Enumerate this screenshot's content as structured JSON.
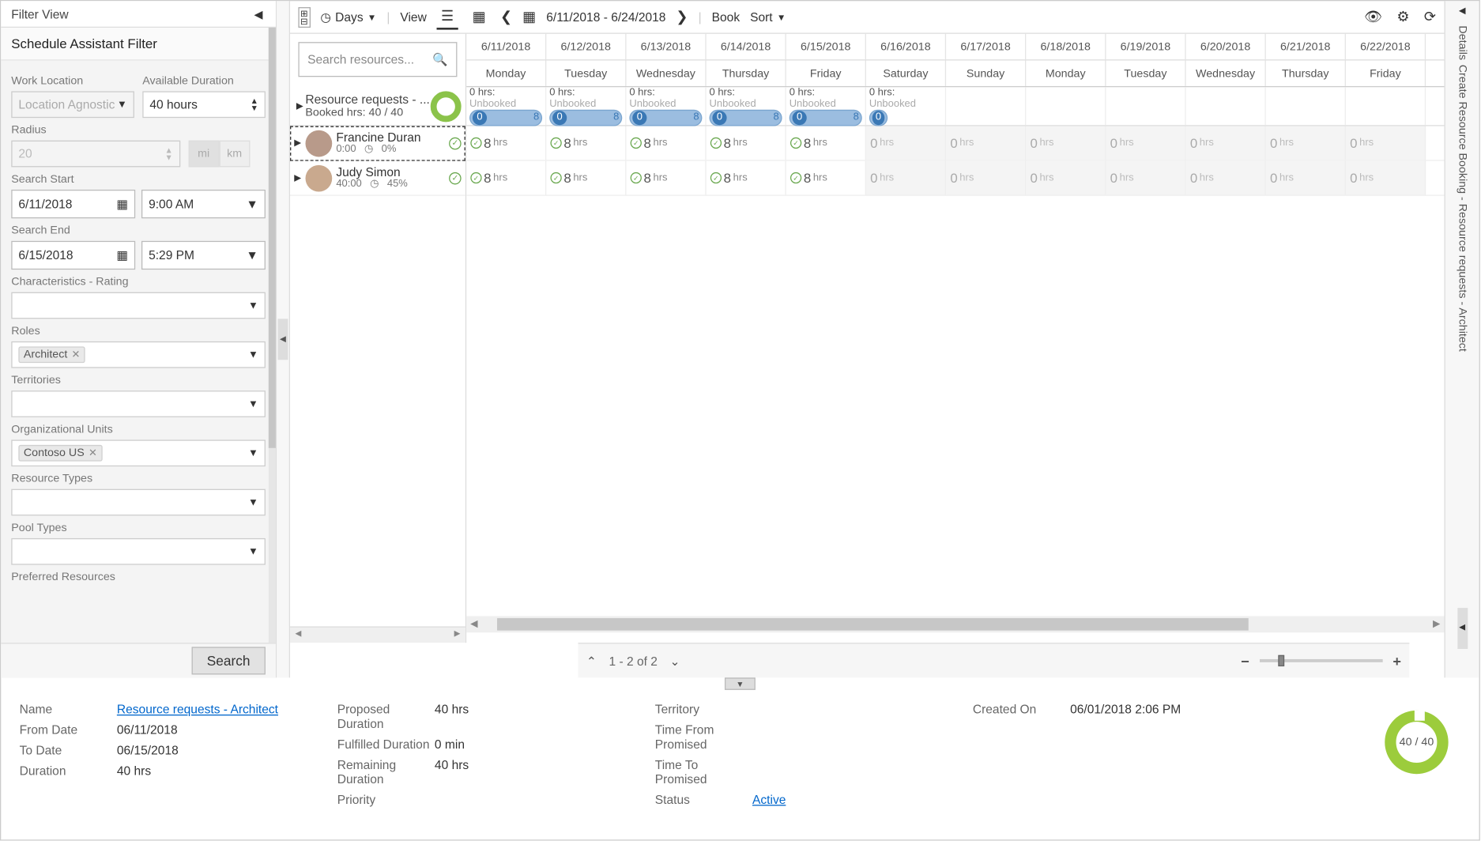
{
  "filterView": {
    "title": "Filter View",
    "subtitle": "Schedule Assistant Filter"
  },
  "filters": {
    "workLocation": {
      "label": "Work Location",
      "value": "Location Agnostic"
    },
    "availDuration": {
      "label": "Available Duration",
      "value": "40 hours"
    },
    "radius": {
      "label": "Radius",
      "value": "20",
      "units": [
        "mi",
        "km"
      ]
    },
    "searchStart": {
      "label": "Search Start",
      "date": "6/11/2018",
      "time": "9:00 AM"
    },
    "searchEnd": {
      "label": "Search End",
      "date": "6/15/2018",
      "time": "5:29 PM"
    },
    "characteristics": {
      "label": "Characteristics - Rating"
    },
    "roles": {
      "label": "Roles",
      "tags": [
        "Architect"
      ]
    },
    "territories": {
      "label": "Territories"
    },
    "orgUnits": {
      "label": "Organizational Units",
      "tags": [
        "Contoso US"
      ]
    },
    "resourceTypes": {
      "label": "Resource Types"
    },
    "poolTypes": {
      "label": "Pool Types"
    },
    "preferred": {
      "label": "Preferred Resources"
    },
    "searchBtn": "Search"
  },
  "toolbar": {
    "days": "Days",
    "view": "View",
    "dateRange": "6/11/2018 - 6/24/2018",
    "book": "Book",
    "sort": "Sort"
  },
  "columns": [
    {
      "date": "6/11/2018",
      "day": "Monday"
    },
    {
      "date": "6/12/2018",
      "day": "Tuesday"
    },
    {
      "date": "6/13/2018",
      "day": "Wednesday"
    },
    {
      "date": "6/14/2018",
      "day": "Thursday"
    },
    {
      "date": "6/15/2018",
      "day": "Friday"
    },
    {
      "date": "6/16/2018",
      "day": "Saturday"
    },
    {
      "date": "6/17/2018",
      "day": "Sunday"
    },
    {
      "date": "6/18/2018",
      "day": "Monday"
    },
    {
      "date": "6/19/2018",
      "day": "Tuesday"
    },
    {
      "date": "6/20/2018",
      "day": "Wednesday"
    },
    {
      "date": "6/21/2018",
      "day": "Thursday"
    },
    {
      "date": "6/22/2018",
      "day": "Friday"
    }
  ],
  "searchRes": {
    "placeholder": "Search resources..."
  },
  "request": {
    "title": "Resource requests - ...",
    "sub": "Booked hrs: 40 / 40",
    "unbooked": "0 hrs:",
    "unbookedLbl": "Unbooked",
    "pillA": "0",
    "pillB": "8"
  },
  "resources": [
    {
      "name": "Francine Duran",
      "h": "0:00",
      "pct": "0%",
      "sel": true
    },
    {
      "name": "Judy Simon",
      "h": "40:00",
      "pct": "45%",
      "sel": false
    }
  ],
  "cells": {
    "avail8": "8",
    "availT": "hrs",
    "zero": "0"
  },
  "pager": {
    "text": "1 - 2 of 2"
  },
  "rightRail": {
    "t1": "Details",
    "t2": "Create Resource Booking - Resource requests - Architect"
  },
  "details": {
    "name": {
      "l": "Name",
      "v": "Resource requests - Architect"
    },
    "from": {
      "l": "From Date",
      "v": "06/11/2018"
    },
    "to": {
      "l": "To Date",
      "v": "06/15/2018"
    },
    "dur": {
      "l": "Duration",
      "v": "40 hrs"
    },
    "prop": {
      "l": "Proposed Duration",
      "v": "40 hrs"
    },
    "ful": {
      "l": "Fulfilled Duration",
      "v": "0 min"
    },
    "rem": {
      "l": "Remaining Duration",
      "v": "40 hrs"
    },
    "pri": {
      "l": "Priority",
      "v": ""
    },
    "terr": {
      "l": "Territory",
      "v": ""
    },
    "tfp": {
      "l": "Time From Promised",
      "v": ""
    },
    "ttp": {
      "l": "Time To Promised",
      "v": ""
    },
    "stat": {
      "l": "Status",
      "v": "Active"
    },
    "cre": {
      "l": "Created On",
      "v": "06/01/2018 2:06 PM"
    },
    "donut": "40 / 40"
  }
}
